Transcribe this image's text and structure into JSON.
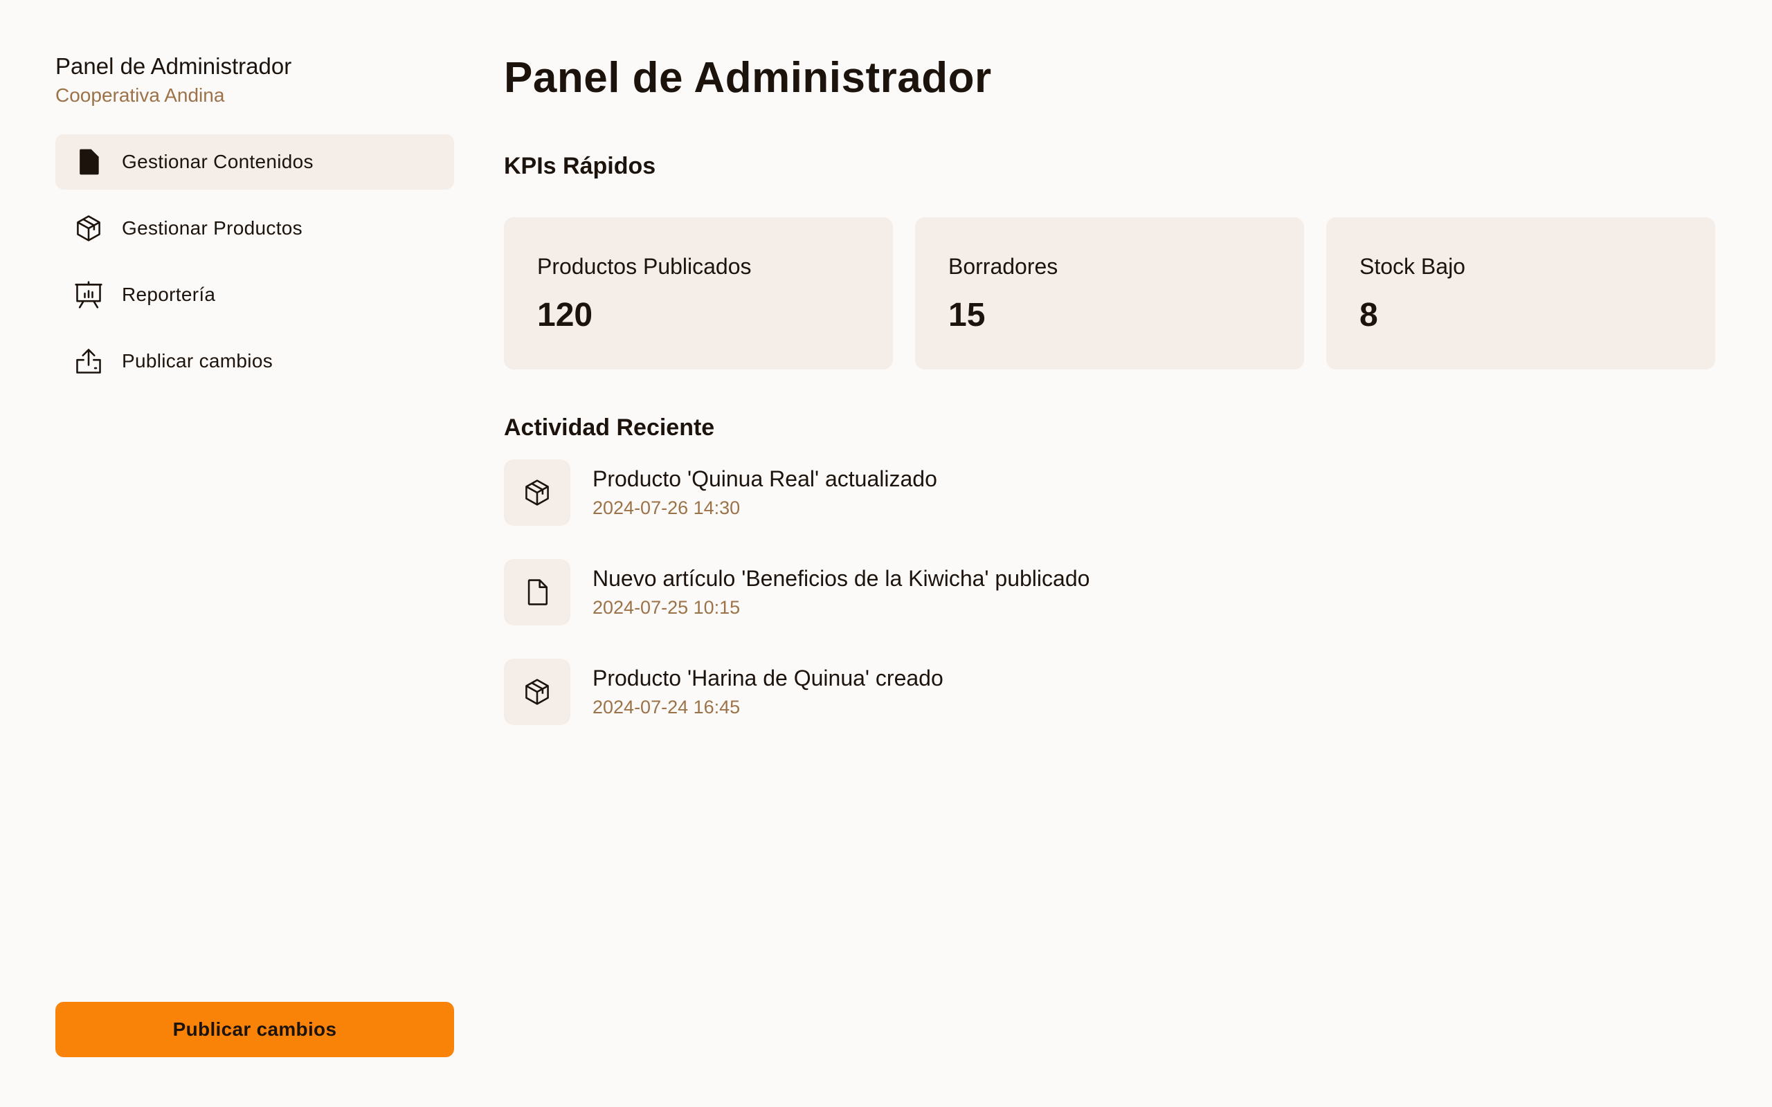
{
  "sidebar": {
    "title": "Panel de Administrador",
    "subtitle": "Cooperativa Andina",
    "items": [
      {
        "label": "Gestionar Contenidos",
        "icon": "file-icon",
        "active": true
      },
      {
        "label": "Gestionar Productos",
        "icon": "package-icon",
        "active": false
      },
      {
        "label": "Reportería",
        "icon": "presentation-chart-icon",
        "active": false
      },
      {
        "label": "Publicar cambios",
        "icon": "upload-icon",
        "active": false
      }
    ],
    "publish_button": "Publicar cambios"
  },
  "main": {
    "title": "Panel de Administrador",
    "kpi_section_title": "KPIs Rápidos",
    "kpis": [
      {
        "label": "Productos Publicados",
        "value": "120"
      },
      {
        "label": "Borradores",
        "value": "15"
      },
      {
        "label": "Stock Bajo",
        "value": "8"
      }
    ],
    "activity_section_title": "Actividad Reciente",
    "activity": [
      {
        "title": "Producto 'Quinua Real' actualizado",
        "time": "2024-07-26 14:30",
        "icon": "package-icon"
      },
      {
        "title": "Nuevo artículo 'Beneficios de la Kiwicha' publicado",
        "time": "2024-07-25 10:15",
        "icon": "file-icon"
      },
      {
        "title": "Producto 'Harina de Quinua' creado",
        "time": "2024-07-24 16:45",
        "icon": "package-icon"
      }
    ]
  },
  "colors": {
    "background": "#fcfaf8",
    "surface": "#f4ede8",
    "accent": "#f98208",
    "muted_text": "#9c7349",
    "text": "#1c130d"
  }
}
